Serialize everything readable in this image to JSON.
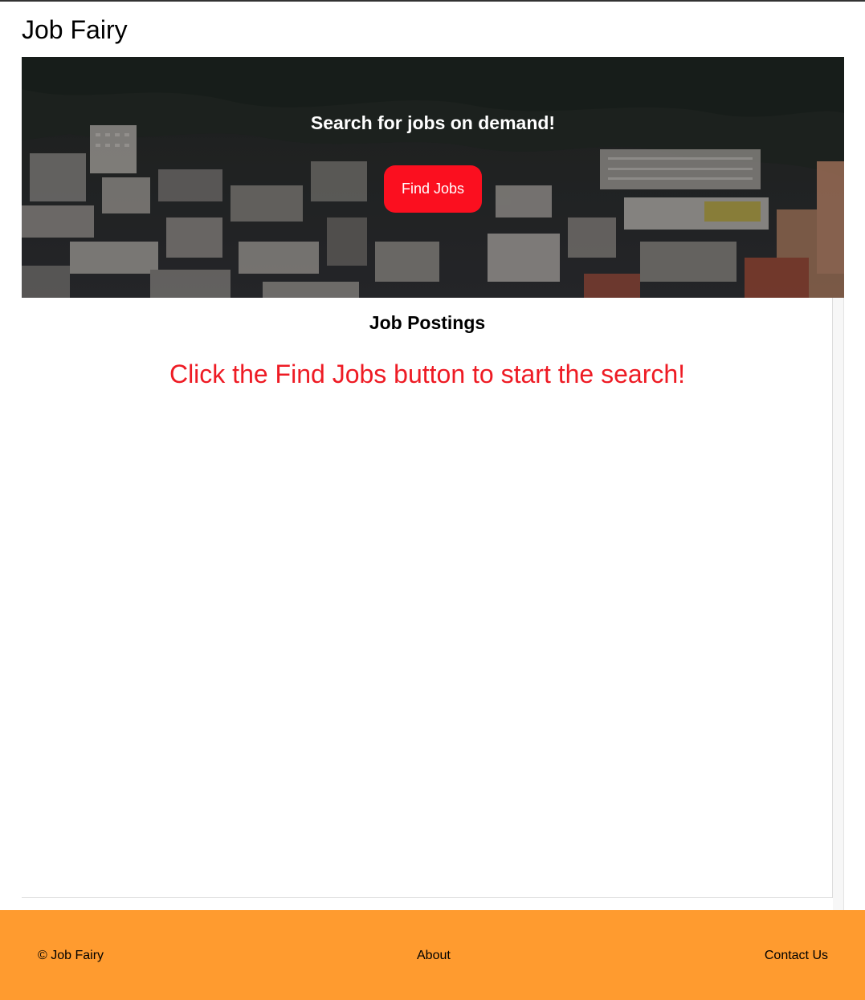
{
  "site": {
    "title": "Job Fairy"
  },
  "hero": {
    "heading": "Search for jobs on demand!",
    "button_label": "Find Jobs"
  },
  "postings": {
    "title": "Job Postings",
    "message": "Click the Find Jobs button to start the search!"
  },
  "footer": {
    "copyright": "© Job Fairy",
    "about": "About",
    "contact": "Contact Us"
  },
  "colors": {
    "accent_red": "#fb0f1f",
    "footer_orange": "#ff9b2f",
    "message_red": "#ee1b24"
  }
}
